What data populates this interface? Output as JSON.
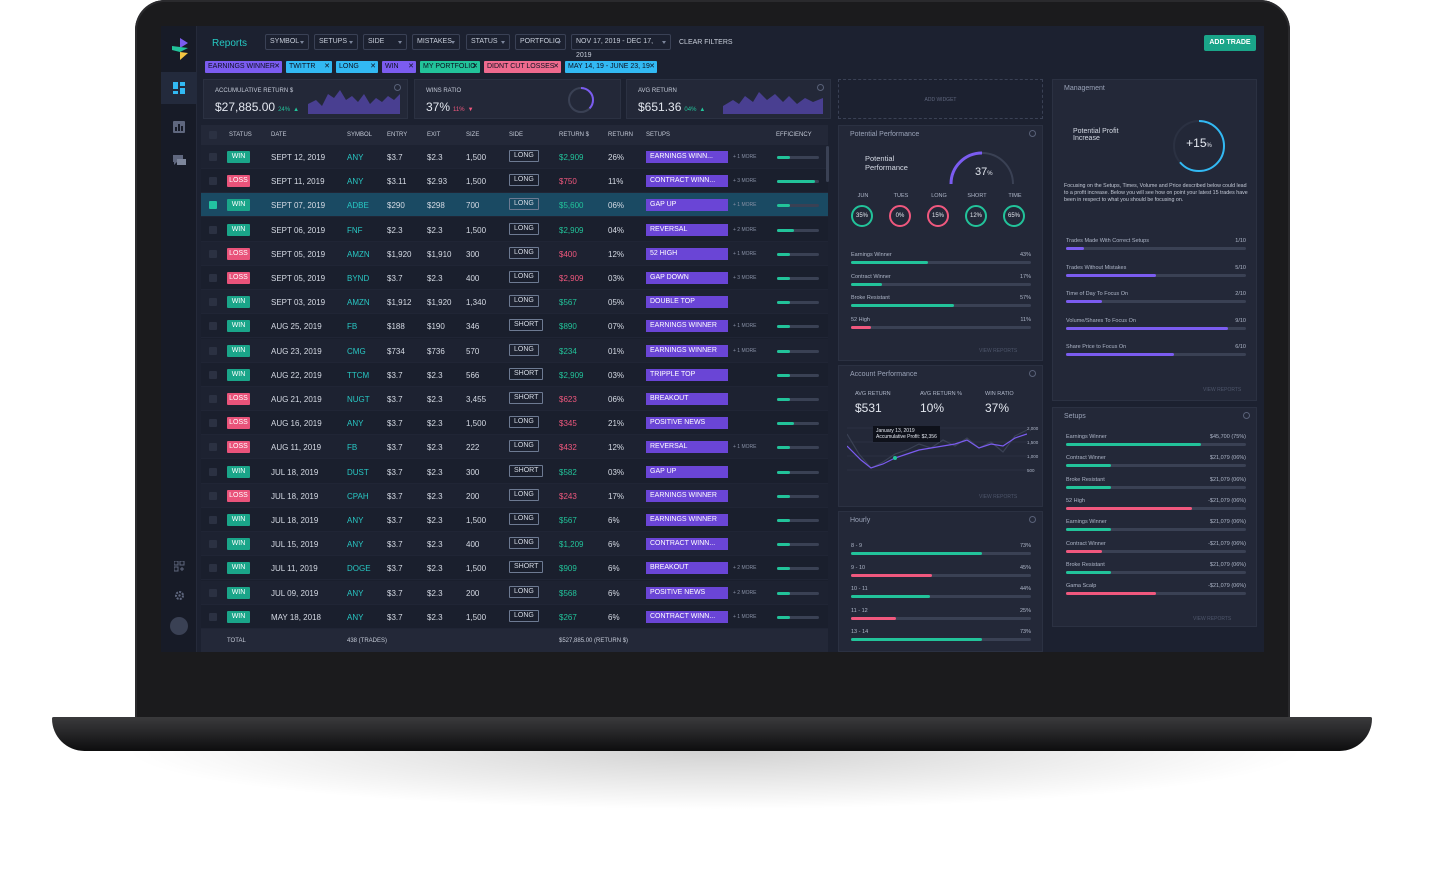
{
  "app": {
    "title": "Reports",
    "add_trade": "ADD TRADE",
    "clear_filters": "CLEAR FILTERS"
  },
  "filters": [
    "SYMBOL",
    "SETUPS",
    "SIDE",
    "MISTAKES",
    "STATUS",
    "PORTFOLIO",
    "NOV 17, 2019 - DEC 17, 2019"
  ],
  "chips": [
    {
      "label": "EARNINGS WINNER",
      "color": "#7b5cf0"
    },
    {
      "label": "TWITTR",
      "color": "#32b9f3"
    },
    {
      "label": "LONG",
      "color": "#32b9f3"
    },
    {
      "label": "WIN",
      "color": "#7b5cf0"
    },
    {
      "label": "MY PORTFOLIO",
      "color": "#22c39a"
    },
    {
      "label": "DIDNT CUT LOSSES",
      "color": "#ef6a8e"
    },
    {
      "label": "MAY 14, 19 - JUNE 23, 19",
      "color": "#32b9f3"
    }
  ],
  "stats": [
    {
      "label": "ACCUMULATIVE RETURN $",
      "value": "$27,885.00",
      "change": "24%",
      "dir": "up"
    },
    {
      "label": "WINS RATIO",
      "value": "37%",
      "change": "11%",
      "dir": "down"
    },
    {
      "label": "AVG RETURN",
      "value": "$651.36",
      "change": "04%",
      "dir": "up"
    }
  ],
  "add_widget": "ADD WIDGET",
  "table": {
    "headers": [
      "STATUS",
      "DATE",
      "SYMBOL",
      "ENTRY",
      "EXIT",
      "SIZE",
      "SIDE",
      "RETURN $",
      "RETURN",
      "SETUPS",
      "EFFICIENCY"
    ],
    "rows": [
      {
        "status": "WIN",
        "date": "SEPT 12, 2019",
        "symbol": "ANY",
        "entry": "$3.7",
        "exit": "$2.3",
        "size": "1,500",
        "side": "LONG",
        "ret": "$2,909",
        "pct": "26%",
        "setup": "EARNINGS WINN...",
        "more": "+ 1 MORE",
        "eff": 0.3
      },
      {
        "status": "LOSS",
        "date": "SEPT 11, 2019",
        "symbol": "ANY",
        "entry": "$3.11",
        "exit": "$2.93",
        "size": "1,500",
        "side": "LONG",
        "ret": "$750",
        "pct": "11%",
        "setup": "CONTRACT WINN...",
        "more": "+ 3 MORE",
        "eff": 0.9
      },
      {
        "status": "WIN",
        "date": "SEPT 07, 2019",
        "symbol": "ADBE",
        "entry": "$290",
        "exit": "$298",
        "size": "700",
        "side": "LONG",
        "ret": "$5,600",
        "pct": "06%",
        "setup": "GAP UP",
        "more": "+ 1 MORE",
        "eff": 0.3,
        "selected": true
      },
      {
        "status": "WIN",
        "date": "SEPT 06, 2019",
        "symbol": "FNF",
        "entry": "$2.3",
        "exit": "$2.3",
        "size": "1,500",
        "side": "LONG",
        "ret": "$2,909",
        "pct": "04%",
        "setup": "REVERSAL",
        "more": "+ 2 MORE",
        "eff": 0.4
      },
      {
        "status": "LOSS",
        "date": "SEPT 05, 2019",
        "symbol": "AMZN",
        "entry": "$1,920",
        "exit": "$1,910",
        "size": "300",
        "side": "LONG",
        "ret": "$400",
        "pct": "12%",
        "setup": "52 HIGH",
        "more": "+ 1 MORE",
        "eff": 0.3
      },
      {
        "status": "LOSS",
        "date": "SEPT 05, 2019",
        "symbol": "BYND",
        "entry": "$3.7",
        "exit": "$2.3",
        "size": "400",
        "side": "LONG",
        "ret": "$2,909",
        "pct": "03%",
        "setup": "GAP DOWN",
        "more": "+ 3 MORE",
        "eff": 0.3
      },
      {
        "status": "WIN",
        "date": "SEPT 03, 2019",
        "symbol": "AMZN",
        "entry": "$1,912",
        "exit": "$1,920",
        "size": "1,340",
        "side": "LONG",
        "ret": "$567",
        "pct": "05%",
        "setup": "DOUBLE TOP",
        "more": "",
        "eff": 0.3
      },
      {
        "status": "WIN",
        "date": "AUG 25, 2019",
        "symbol": "FB",
        "entry": "$188",
        "exit": "$190",
        "size": "346",
        "side": "SHORT",
        "ret": "$890",
        "pct": "07%",
        "setup": "EARNINGS WINNER",
        "more": "+ 1 MORE",
        "eff": 0.3
      },
      {
        "status": "WIN",
        "date": "AUG 23, 2019",
        "symbol": "CMG",
        "entry": "$734",
        "exit": "$736",
        "size": "570",
        "side": "LONG",
        "ret": "$234",
        "pct": "01%",
        "setup": "EARNINGS WINNER",
        "more": "+ 1 MORE",
        "eff": 0.3
      },
      {
        "status": "WIN",
        "date": "AUG 22, 2019",
        "symbol": "TTCM",
        "entry": "$3.7",
        "exit": "$2.3",
        "size": "566",
        "side": "SHORT",
        "ret": "$2,909",
        "pct": "03%",
        "setup": "TRIPPLE TOP",
        "more": "",
        "eff": 0.3
      },
      {
        "status": "LOSS",
        "date": "AUG 21, 2019",
        "symbol": "NUGT",
        "entry": "$3.7",
        "exit": "$2.3",
        "size": "3,455",
        "side": "SHORT",
        "ret": "$623",
        "pct": "06%",
        "setup": "BREAKOUT",
        "more": "",
        "eff": 0.3
      },
      {
        "status": "LOSS",
        "date": "AUG 16, 2019",
        "symbol": "ANY",
        "entry": "$3.7",
        "exit": "$2.3",
        "size": "1,500",
        "side": "LONG",
        "ret": "$345",
        "pct": "21%",
        "setup": "POSITIVE NEWS",
        "more": "",
        "eff": 0.4
      },
      {
        "status": "LOSS",
        "date": "AUG 11, 2019",
        "symbol": "FB",
        "entry": "$3.7",
        "exit": "$2.3",
        "size": "222",
        "side": "LONG",
        "ret": "$432",
        "pct": "12%",
        "setup": "REVERSAL",
        "more": "+ 1 MORE",
        "eff": 0.3
      },
      {
        "status": "WIN",
        "date": "JUL 18, 2019",
        "symbol": "DUST",
        "entry": "$3.7",
        "exit": "$2.3",
        "size": "300",
        "side": "SHORT",
        "ret": "$582",
        "pct": "03%",
        "setup": "GAP UP",
        "more": "",
        "eff": 0.3
      },
      {
        "status": "LOSS",
        "date": "JUL 18, 2019",
        "symbol": "CPAH",
        "entry": "$3.7",
        "exit": "$2.3",
        "size": "200",
        "side": "LONG",
        "ret": "$243",
        "pct": "17%",
        "setup": "EARNINGS WINNER",
        "more": "",
        "eff": 0.3
      },
      {
        "status": "WIN",
        "date": "JUL 18, 2019",
        "symbol": "ANY",
        "entry": "$3.7",
        "exit": "$2.3",
        "size": "1,500",
        "side": "LONG",
        "ret": "$567",
        "pct": "6%",
        "setup": "EARNINGS WINNER",
        "more": "",
        "eff": 0.3
      },
      {
        "status": "WIN",
        "date": "JUL 15, 2019",
        "symbol": "ANY",
        "entry": "$3.7",
        "exit": "$2.3",
        "size": "400",
        "side": "LONG",
        "ret": "$1,209",
        "pct": "6%",
        "setup": "CONTRACT WINN...",
        "more": "",
        "eff": 0.3
      },
      {
        "status": "WIN",
        "date": "JUL 11, 2019",
        "symbol": "DOGE",
        "entry": "$3.7",
        "exit": "$2.3",
        "size": "1,500",
        "side": "SHORT",
        "ret": "$909",
        "pct": "6%",
        "setup": "BREAKOUT",
        "more": "+ 2 MORE",
        "eff": 0.3
      },
      {
        "status": "WIN",
        "date": "JUL 09, 2019",
        "symbol": "ANY",
        "entry": "$3.7",
        "exit": "$2.3",
        "size": "200",
        "side": "LONG",
        "ret": "$568",
        "pct": "6%",
        "setup": "POSITIVE NEWS",
        "more": "+ 2 MORE",
        "eff": 0.3
      },
      {
        "status": "WIN",
        "date": "MAY  18, 2018",
        "symbol": "ANY",
        "entry": "$3.7",
        "exit": "$2.3",
        "size": "1,500",
        "side": "LONG",
        "ret": "$267",
        "pct": "6%",
        "setup": "CONTRACT WINN...",
        "more": "+ 1 MORE",
        "eff": 0.3
      }
    ],
    "footer": {
      "label": "TOTAL",
      "trades": "438 (TRADES)",
      "ret": "$527,885.00 (RETURN $)"
    }
  },
  "potential": {
    "title": "Potential  Performance",
    "label": "Potential Performance",
    "value": "37",
    "pct_suffix": "%",
    "rings": [
      {
        "label": "JUN",
        "value": "35%",
        "color": "#22c39a"
      },
      {
        "label": "TUES",
        "value": "0%",
        "color": "#f0587e"
      },
      {
        "label": "LONG",
        "value": "15%",
        "color": "#f0587e"
      },
      {
        "label": "SHORT",
        "value": "12%",
        "color": "#22c39a"
      },
      {
        "label": "TIME",
        "value": "65%",
        "color": "#22c39a"
      }
    ],
    "bars": [
      {
        "label": "Earnings Winner",
        "value": "43%",
        "fill": 0.43,
        "color": "#22c39a"
      },
      {
        "label": "Contract Winner",
        "value": "17%",
        "fill": 0.17,
        "color": "#22c39a"
      },
      {
        "label": "Broke Resistant",
        "value": "57%",
        "fill": 0.57,
        "color": "#22c39a"
      },
      {
        "label": "52 High",
        "value": "11%",
        "fill": 0.11,
        "color": "#f0587e"
      }
    ],
    "view": "VIEW REPORTS"
  },
  "account": {
    "title": "Account Performance",
    "metrics": [
      {
        "label": "AVG RETURN",
        "value": "$531"
      },
      {
        "label": "AVG RETURN %",
        "value": "10%"
      },
      {
        "label": "WIN RATIO",
        "value": "37%"
      }
    ],
    "tooltip_date": "January 13, 2019",
    "tooltip_value": "Accumulative Profit: $2,356",
    "y_ticks": [
      "2,000",
      "1,500",
      "1,000",
      "500"
    ],
    "view": "VIEW REPORTS"
  },
  "hourly": {
    "title": "Hourly",
    "bars": [
      {
        "label": "8 - 9",
        "value": "73%",
        "fill": 0.73,
        "color": "#22c39a"
      },
      {
        "label": "9 - 10",
        "value": "45%",
        "fill": 0.45,
        "color": "#f0587e"
      },
      {
        "label": "10 - 11",
        "value": "44%",
        "fill": 0.44,
        "color": "#22c39a"
      },
      {
        "label": "11 - 12",
        "value": "25%",
        "fill": 0.25,
        "color": "#f0587e"
      },
      {
        "label": "13 - 14",
        "value": "73%",
        "fill": 0.73,
        "color": "#22c39a"
      }
    ]
  },
  "management": {
    "title": "Management",
    "label": "Potential Profit Increase",
    "value": "+15",
    "pct_suffix": "%",
    "description": "Focusing on the Setups, Times, Volume and Price described below could lead to a profit increase. Below you will see how on point your latest 15 trades have been in respect to what you should be focusing on.",
    "bars": [
      {
        "label": "Trades Made With Correct Setups",
        "value": "1/10",
        "fill": 0.1
      },
      {
        "label": "Trades Without Mistakes",
        "value": "5/10",
        "fill": 0.5
      },
      {
        "label": "Time of Day To Focus On",
        "value": "2/10",
        "fill": 0.2
      },
      {
        "label": "Volume/Shares To Focus On",
        "value": "9/10",
        "fill": 0.9
      },
      {
        "label": "Share Price to Focus On",
        "value": "6/10",
        "fill": 0.6
      }
    ],
    "view": "VIEW REPORTS"
  },
  "setups": {
    "title": "Setups",
    "bars": [
      {
        "label": "Earnings Winner",
        "value": "$45,700 (75%)",
        "fill": 0.75,
        "color": "#22c39a"
      },
      {
        "label": "Contract Winner",
        "value": "$21,079 (06%)",
        "fill": 0.25,
        "color": "#22c39a"
      },
      {
        "label": "Broke Resistant",
        "value": "$21,079 (06%)",
        "fill": 0.25,
        "color": "#22c39a"
      },
      {
        "label": "52 High",
        "value": "-$21,079 (06%)",
        "fill": 0.7,
        "color": "#f0587e"
      },
      {
        "label": "Earnings Winner",
        "value": "$21,079 (06%)",
        "fill": 0.25,
        "color": "#22c39a"
      },
      {
        "label": "Contract Winner",
        "value": "-$21,079 (06%)",
        "fill": 0.2,
        "color": "#f0587e"
      },
      {
        "label": "Broke Resistant",
        "value": "$21,079 (06%)",
        "fill": 0.25,
        "color": "#22c39a"
      },
      {
        "label": "Gama Scalp",
        "value": "-$21,079 (06%)",
        "fill": 0.5,
        "color": "#f0587e"
      }
    ],
    "view": "VIEW REPORTS"
  }
}
